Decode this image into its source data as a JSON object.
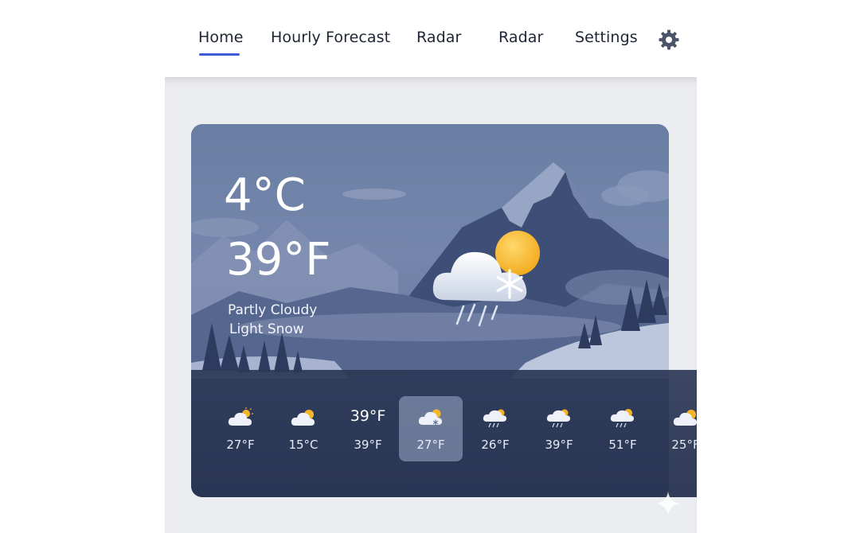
{
  "nav": {
    "items": [
      {
        "label": "Home",
        "active": true
      },
      {
        "label": "Hourly Forecast"
      },
      {
        "label": "Radar"
      },
      {
        "label": "Radar"
      },
      {
        "label": "Settings"
      }
    ],
    "gear_icon": "gear-icon",
    "accent_color": "#3d5bd6"
  },
  "current": {
    "temp_c": "4°C",
    "temp_f": "39°F",
    "condition_1": "Partly Cloudy",
    "condition_2": "Light Snow",
    "icon": "partly-cloudy-snow-icon"
  },
  "hourly": [
    {
      "icon": "partly-sunny-icon",
      "label": "27°F"
    },
    {
      "icon": "partly-sunny-icon",
      "label": "15°C"
    },
    {
      "icon": "none",
      "top_text": "39°F",
      "label": "39°F"
    },
    {
      "icon": "partly-cloudy-snow-icon",
      "label": "27°F",
      "selected": true
    },
    {
      "icon": "rain-sun-icon",
      "label": "26°F"
    },
    {
      "icon": "rain-sun-icon",
      "label": "39°F"
    },
    {
      "icon": "rain-sun-icon",
      "label": "51°F"
    },
    {
      "icon": "partly-sunny-icon",
      "label": "25°F"
    }
  ]
}
